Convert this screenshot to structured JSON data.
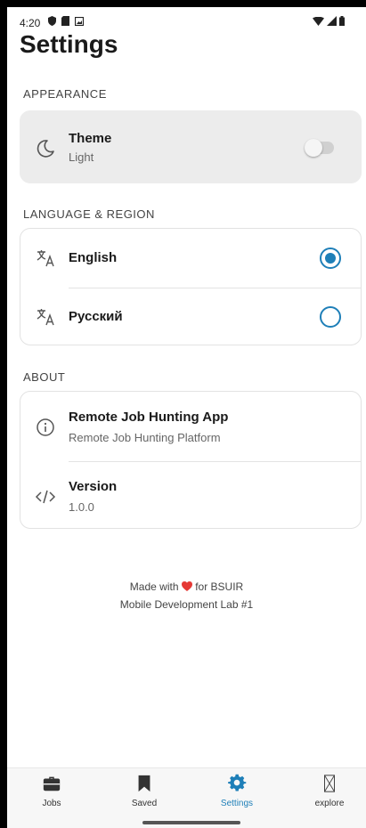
{
  "status_bar": {
    "time": "4:20",
    "left_icons": [
      "shield-icon",
      "sd-card-icon",
      "photo-icon"
    ],
    "right_icons": [
      "wifi-icon",
      "signal-icon",
      "battery-icon"
    ]
  },
  "page_title": "Settings",
  "appearance": {
    "section_label": "APPEARANCE",
    "theme": {
      "title": "Theme",
      "subtitle": "Light",
      "icon": "moon-icon",
      "enabled": false
    }
  },
  "language": {
    "section_label": "LANGUAGE & REGION",
    "options": [
      {
        "label": "English",
        "icon": "translate-icon",
        "selected": true
      },
      {
        "label": "Русский",
        "icon": "translate-icon",
        "selected": false
      }
    ]
  },
  "about": {
    "section_label": "ABOUT",
    "items": [
      {
        "title": "Remote Job Hunting App",
        "subtitle": "Remote Job Hunting Platform",
        "icon": "info-icon"
      },
      {
        "title": "Version",
        "subtitle": "1.0.0",
        "icon": "code-icon"
      }
    ]
  },
  "footer": {
    "line1_prefix": "Made with",
    "line1_suffix": "for BSUIR",
    "line2": "Mobile Development Lab #1",
    "heart_color": "#e53935"
  },
  "bottom_nav": {
    "items": [
      {
        "label": "Jobs",
        "icon": "briefcase-icon",
        "active": false
      },
      {
        "label": "Saved",
        "icon": "bookmark-icon",
        "active": false
      },
      {
        "label": "Settings",
        "icon": "gear-icon",
        "active": true
      },
      {
        "label": "explore",
        "icon": "hourglass-icon",
        "active": false
      }
    ]
  },
  "colors": {
    "accent": "#1e7fb8",
    "card_grey": "#ececec"
  }
}
